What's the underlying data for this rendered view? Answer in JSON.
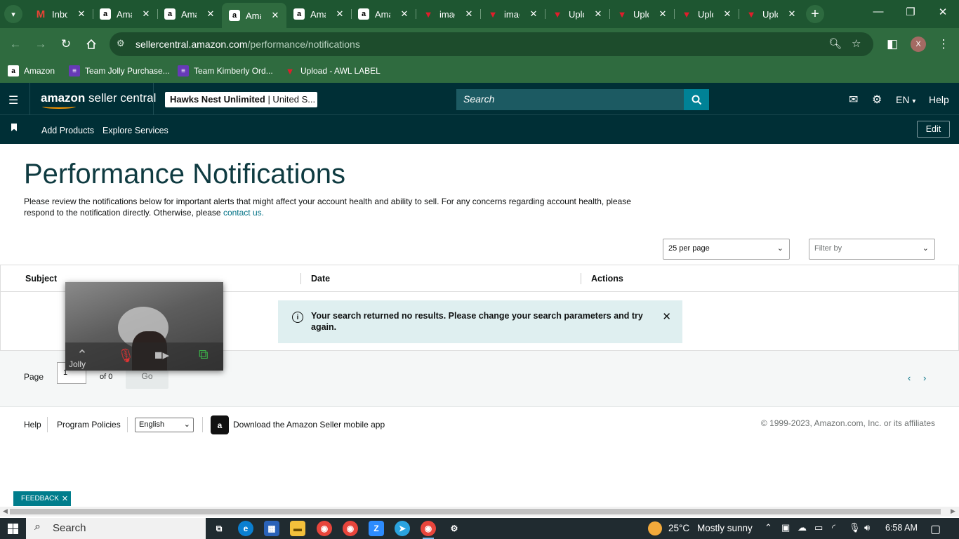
{
  "browser": {
    "tabs": [
      {
        "title": "Inbox",
        "favicon": "gmail"
      },
      {
        "title": "Amazon",
        "favicon": "amazon"
      },
      {
        "title": "Amazon",
        "favicon": "amazon"
      },
      {
        "title": "Amazon",
        "favicon": "amazon",
        "active": true
      },
      {
        "title": "Amazon",
        "favicon": "amazon"
      },
      {
        "title": "Amazon",
        "favicon": "amazon"
      },
      {
        "title": "image",
        "favicon": "awl"
      },
      {
        "title": "image",
        "favicon": "awl"
      },
      {
        "title": "Upload",
        "favicon": "awl"
      },
      {
        "title": "Upload",
        "favicon": "awl"
      },
      {
        "title": "Upload",
        "favicon": "awl"
      },
      {
        "title": "Upload",
        "favicon": "awl"
      }
    ],
    "url_host": "sellercentral.amazon.com",
    "url_path": "/performance/notifications",
    "profile_initial": "X",
    "bookmarks": [
      {
        "label": "Amazon",
        "icon": "amazon-icon"
      },
      {
        "label": "Team Jolly Purchase...",
        "icon": "forms-icon"
      },
      {
        "label": "Team Kimberly Ord...",
        "icon": "forms-icon"
      },
      {
        "label": "Upload - AWL LABEL",
        "icon": "awl-icon"
      }
    ]
  },
  "header": {
    "logo_bold": "amazon",
    "logo_rest": " seller central",
    "store_name": "Hawks Nest Unlimited",
    "store_region": " | United S...",
    "search_placeholder": "Search",
    "language": "EN",
    "help": "Help"
  },
  "subnav": {
    "links": [
      "Add Products",
      "Explore Services"
    ],
    "edit": "Edit"
  },
  "page": {
    "title": "Performance Notifications",
    "intro": "Please review the notifications below for important alerts that might affect your account health and ability to sell. For any concerns regarding account health, please respond to the notification directly. Otherwise, please ",
    "intro_link": "contact us.",
    "per_page": "25 per page",
    "filter_placeholder": "Filter by",
    "columns": [
      "Subject",
      "Date",
      "Actions"
    ],
    "alert": "Your search returned no results. Please change your search parameters and try again."
  },
  "pager": {
    "label": "Page",
    "value": "1",
    "of": "of 0",
    "go": "Go"
  },
  "footer": {
    "help": "Help",
    "policies": "Program Policies",
    "language": "English",
    "app": "Download the Amazon Seller mobile app",
    "copyright": "© 1999-2023, Amazon.com, Inc. or its affiliates"
  },
  "feedback": "FEEDBACK",
  "video_overlay": {
    "name": "Jolly"
  },
  "taskbar": {
    "search": "Search",
    "temperature": "25°C",
    "weather": "Mostly sunny",
    "time": "6:58 AM"
  },
  "colors": {
    "browser_frame": "#1e5631",
    "seller_header": "#002f36",
    "accent_teal": "#008296",
    "alert_bg": "#dfeff0",
    "link": "#007185"
  }
}
